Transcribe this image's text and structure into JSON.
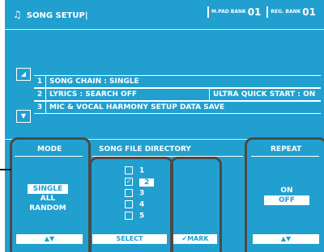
{
  "header": {
    "note_icon": "music-note-icon",
    "title": "SONG SETUP|",
    "mpad_small": "M.PAD BANK",
    "mpad_value": "01",
    "reg_small": "REG. BANK",
    "reg_value": "01"
  },
  "chain": {
    "rows": [
      {
        "num": "1",
        "text": "SONG CHAIN   : SINGLE"
      },
      {
        "num": "2",
        "text": "LYRICS : SEARCH OFF"
      },
      {
        "num": "3",
        "text": "MIC & VOCAL HARMONY SETUP DATA SAVE"
      }
    ],
    "ultra": "ULTRA QUICK START : ON"
  },
  "mode": {
    "header": "MODE",
    "options": [
      "SINGLE",
      "ALL",
      "RANDOM"
    ],
    "selected": "SINGLE",
    "arrows": "▲▼"
  },
  "directory": {
    "header": "SONG FILE DIRECTORY",
    "files": [
      {
        "label": "1",
        "checked": false
      },
      {
        "label": "2",
        "checked": true
      },
      {
        "label": "3",
        "checked": false
      },
      {
        "label": "4",
        "checked": false
      },
      {
        "label": "5",
        "checked": false
      }
    ],
    "select_label": "SELECT",
    "mark_label": "✔MARK"
  },
  "repeat": {
    "header": "REPEAT",
    "options": [
      "ON",
      "OFF"
    ],
    "selected": "OFF",
    "arrows": "▲▼"
  },
  "colors": {
    "lcd_bg": "#21a0cf",
    "text": "#ffffff",
    "callout": "#4a4a4a"
  }
}
